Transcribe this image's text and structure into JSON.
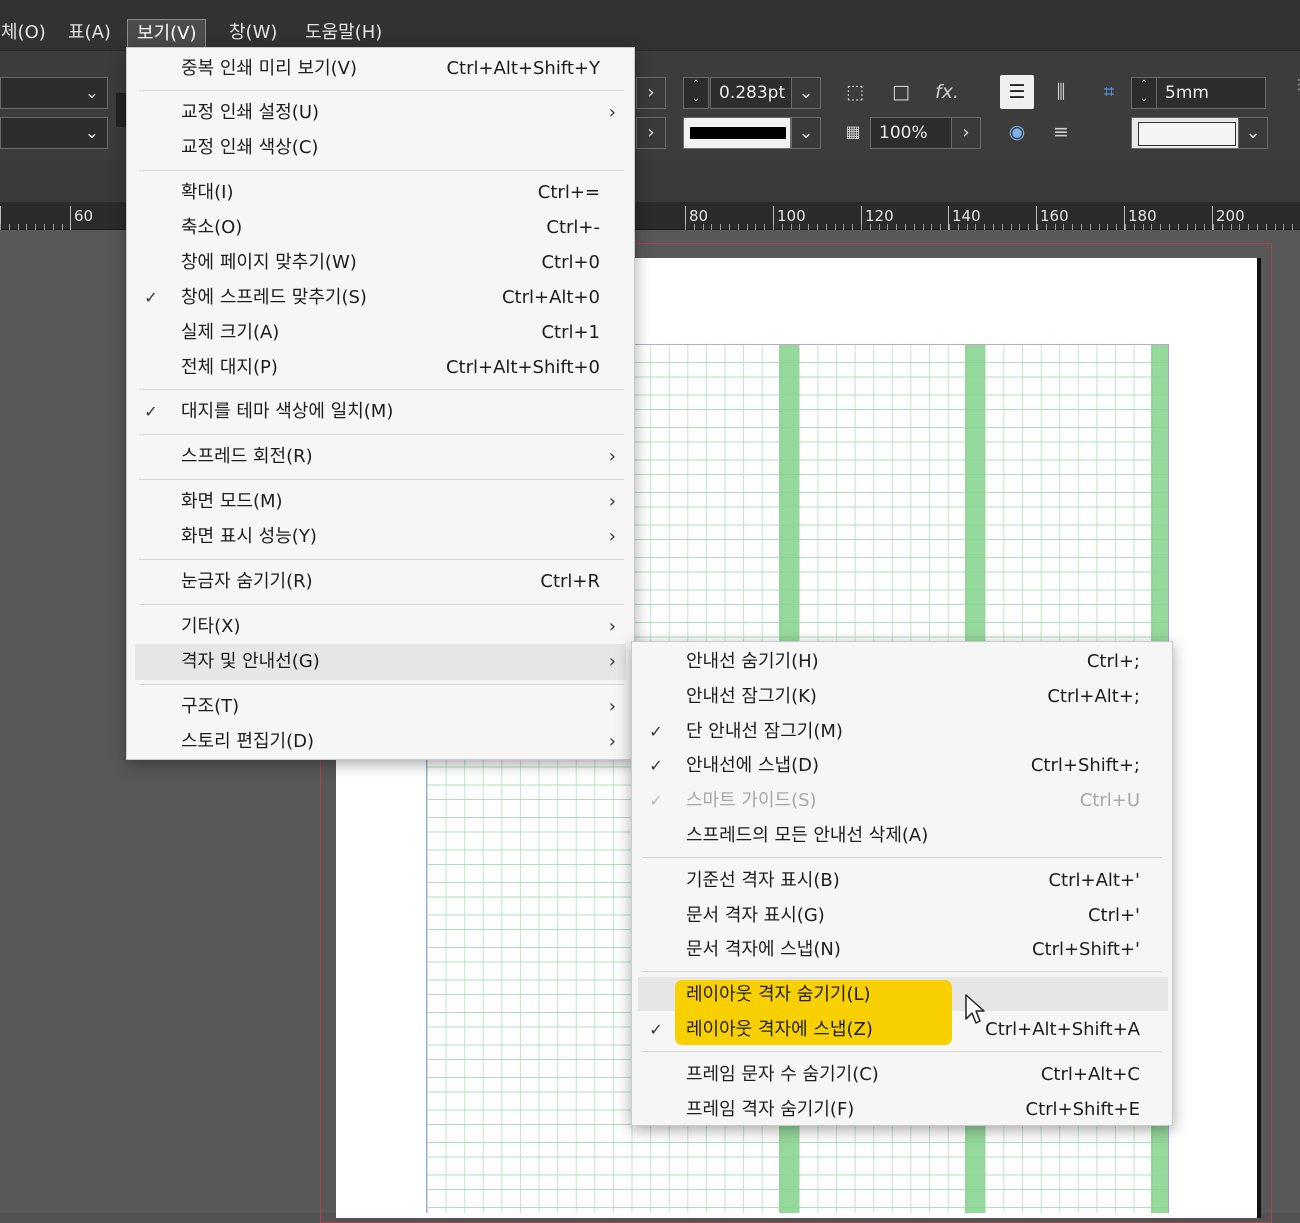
{
  "menubar": {
    "items": [
      "체(O)",
      "표(A)",
      "보기(V)",
      "창(W)",
      "도움말(H)"
    ]
  },
  "toolbar": {
    "stroke_weight": "0.283pt",
    "opacity": "100%",
    "gutter": "5mm",
    "arrow_right": "›",
    "chevron_down": "⌄",
    "fx_label": "fx."
  },
  "ruler": {
    "labels": [
      "60",
      "80",
      "100",
      "120",
      "140",
      "160",
      "180",
      "200"
    ]
  },
  "view_menu": {
    "items": [
      {
        "label": "중복 인쇄 미리 보기(V)",
        "shortcut": "Ctrl+Alt+Shift+Y",
        "check": "",
        "arrow": ""
      },
      {
        "label": "교정 인쇄 설정(U)",
        "shortcut": "",
        "check": "",
        "arrow": "›"
      },
      {
        "label": "교정 인쇄 색상(C)",
        "shortcut": "",
        "check": "",
        "arrow": ""
      },
      {
        "label": "확대(I)",
        "shortcut": "Ctrl+=",
        "check": "",
        "arrow": ""
      },
      {
        "label": "축소(O)",
        "shortcut": "Ctrl+-",
        "check": "",
        "arrow": ""
      },
      {
        "label": "창에 페이지 맞추기(W)",
        "shortcut": "Ctrl+0",
        "check": "",
        "arrow": ""
      },
      {
        "label": "창에 스프레드 맞추기(S)",
        "shortcut": "Ctrl+Alt+0",
        "check": "✓",
        "arrow": ""
      },
      {
        "label": "실제 크기(A)",
        "shortcut": "Ctrl+1",
        "check": "",
        "arrow": ""
      },
      {
        "label": "전체 대지(P)",
        "shortcut": "Ctrl+Alt+Shift+0",
        "check": "",
        "arrow": ""
      },
      {
        "label": "대지를 테마 색상에 일치(M)",
        "shortcut": "",
        "check": "✓",
        "arrow": ""
      },
      {
        "label": "스프레드 회전(R)",
        "shortcut": "",
        "check": "",
        "arrow": "›"
      },
      {
        "label": "화면 모드(M)",
        "shortcut": "",
        "check": "",
        "arrow": "›"
      },
      {
        "label": "화면 표시 성능(Y)",
        "shortcut": "",
        "check": "",
        "arrow": "›"
      },
      {
        "label": "눈금자 숨기기(R)",
        "shortcut": "Ctrl+R",
        "check": "",
        "arrow": ""
      },
      {
        "label": "기타(X)",
        "shortcut": "",
        "check": "",
        "arrow": "›"
      },
      {
        "label": "격자 및 안내선(G)",
        "shortcut": "",
        "check": "",
        "arrow": "›"
      },
      {
        "label": "구조(T)",
        "shortcut": "",
        "check": "",
        "arrow": "›"
      },
      {
        "label": "스토리 편집기(D)",
        "shortcut": "",
        "check": "",
        "arrow": "›"
      }
    ]
  },
  "grid_submenu": {
    "items": [
      {
        "label": "안내선 숨기기(H)",
        "shortcut": "Ctrl+;",
        "check": ""
      },
      {
        "label": "안내선 잠그기(K)",
        "shortcut": "Ctrl+Alt+;",
        "check": ""
      },
      {
        "label": "단 안내선 잠그기(M)",
        "shortcut": "",
        "check": "✓"
      },
      {
        "label": "안내선에 스냅(D)",
        "shortcut": "Ctrl+Shift+;",
        "check": "✓"
      },
      {
        "label": "스마트 가이드(S)",
        "shortcut": "Ctrl+U",
        "check": "✓"
      },
      {
        "label": "스프레드의 모든 안내선 삭제(A)",
        "shortcut": "",
        "check": ""
      },
      {
        "label": "기준선 격자 표시(B)",
        "shortcut": "Ctrl+Alt+'",
        "check": ""
      },
      {
        "label": "문서 격자 표시(G)",
        "shortcut": "Ctrl+'",
        "check": ""
      },
      {
        "label": "문서 격자에 스냅(N)",
        "shortcut": "Ctrl+Shift+'",
        "check": ""
      },
      {
        "label": "레이아웃 격자 숨기기(L)",
        "shortcut": "",
        "check": ""
      },
      {
        "label": "레이아웃 격자에 스냅(Z)",
        "shortcut": "Ctrl+Alt+Shift+A",
        "check": "✓"
      },
      {
        "label": "프레임 문자 수 숨기기(C)",
        "shortcut": "Ctrl+Alt+C",
        "check": ""
      },
      {
        "label": "프레임 격자 숨기기(F)",
        "shortcut": "Ctrl+Shift+E",
        "check": ""
      }
    ]
  },
  "colors": {
    "highlight": "#f8d000",
    "layout_grid": "#84d28c",
    "menubar": "#323232"
  }
}
